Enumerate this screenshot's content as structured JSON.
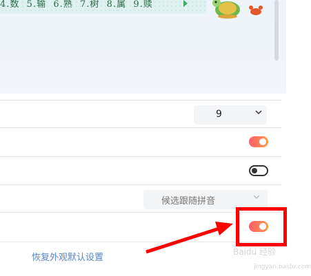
{
  "preview": {
    "candidates": "4.数  5.输  6.熟  7.树  8.属  9.赎"
  },
  "settings": {
    "row1": {
      "select_value": "9"
    },
    "row2": {
      "toggle_state": "on"
    },
    "row3": {
      "toggle_state": "off"
    },
    "row4": {
      "select_value": "候选跟随拼音"
    },
    "row5": {
      "toggle_state": "on"
    }
  },
  "footer": {
    "restore_link": "恢复外观默认设置"
  },
  "watermark": {
    "brand": "Baidu 经验",
    "url": "jingyan.baidu.com"
  },
  "colors": {
    "toggle_on_start": "#ff5c6a",
    "toggle_on_end": "#ff9a4a",
    "link": "#5a86c8",
    "annotation": "#ff0000"
  }
}
